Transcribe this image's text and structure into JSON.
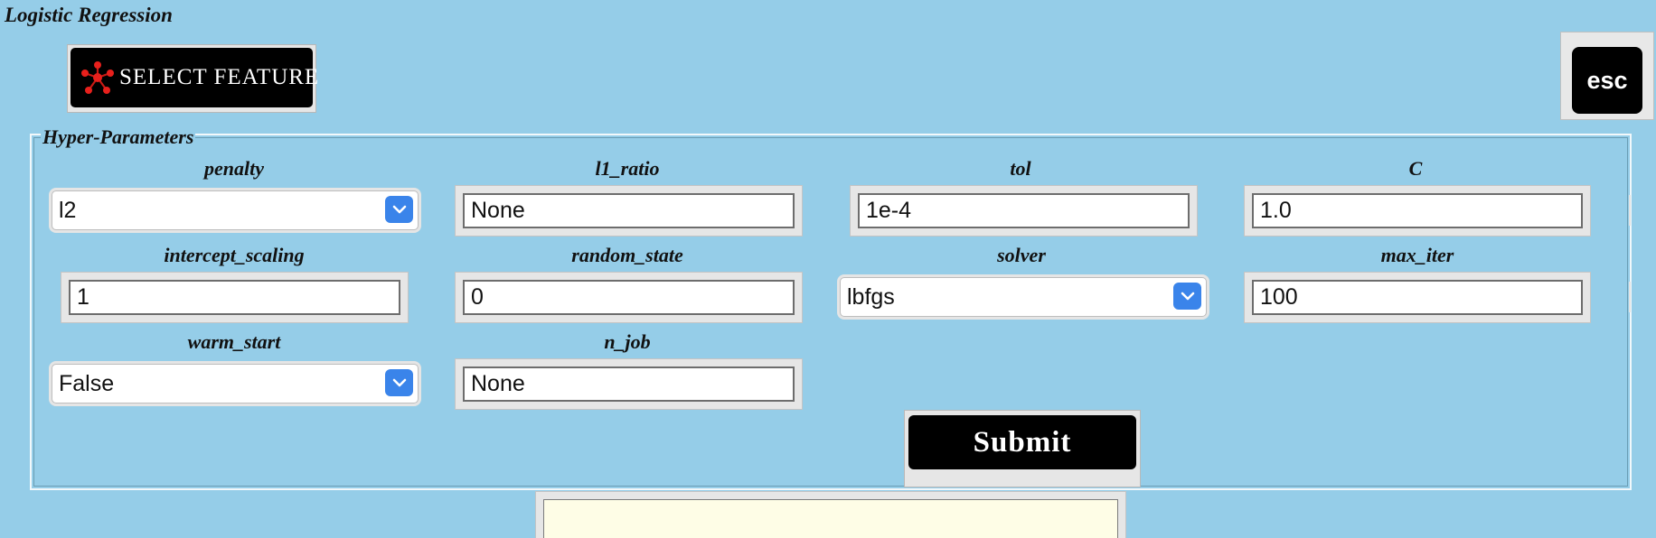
{
  "window": {
    "title": "Logistic Regression"
  },
  "toolbar": {
    "select_feature_label": "SELECT FEATURE",
    "esc_label": "esc"
  },
  "hyper_parameters": {
    "legend": "Hyper-Parameters",
    "penalty": {
      "label": "penalty",
      "value": "l2"
    },
    "l1_ratio": {
      "label": "l1_ratio",
      "value": "None"
    },
    "tol": {
      "label": "tol",
      "value": "1e-4"
    },
    "C": {
      "label": "C",
      "value": "1.0"
    },
    "intercept_scaling": {
      "label": "intercept_scaling",
      "value": "1"
    },
    "random_state": {
      "label": "random_state",
      "value": "0"
    },
    "solver": {
      "label": "solver",
      "value": "lbfgs"
    },
    "max_iter": {
      "label": "max_iter",
      "value": "100"
    },
    "warm_start": {
      "label": "warm_start",
      "value": "False"
    },
    "n_job": {
      "label": "n_job",
      "value": "None"
    }
  },
  "submit": {
    "label": "Submit"
  },
  "output": {
    "text": ""
  },
  "icons": {
    "select_feature": "network-star-icon",
    "dropdown": "chevron-down-icon"
  },
  "colors": {
    "background": "#95cde8",
    "button": "#000000",
    "dropdown_accent": "#3a84ea",
    "output_background": "#fefde6",
    "select_feature_icon": "#e8201c"
  }
}
